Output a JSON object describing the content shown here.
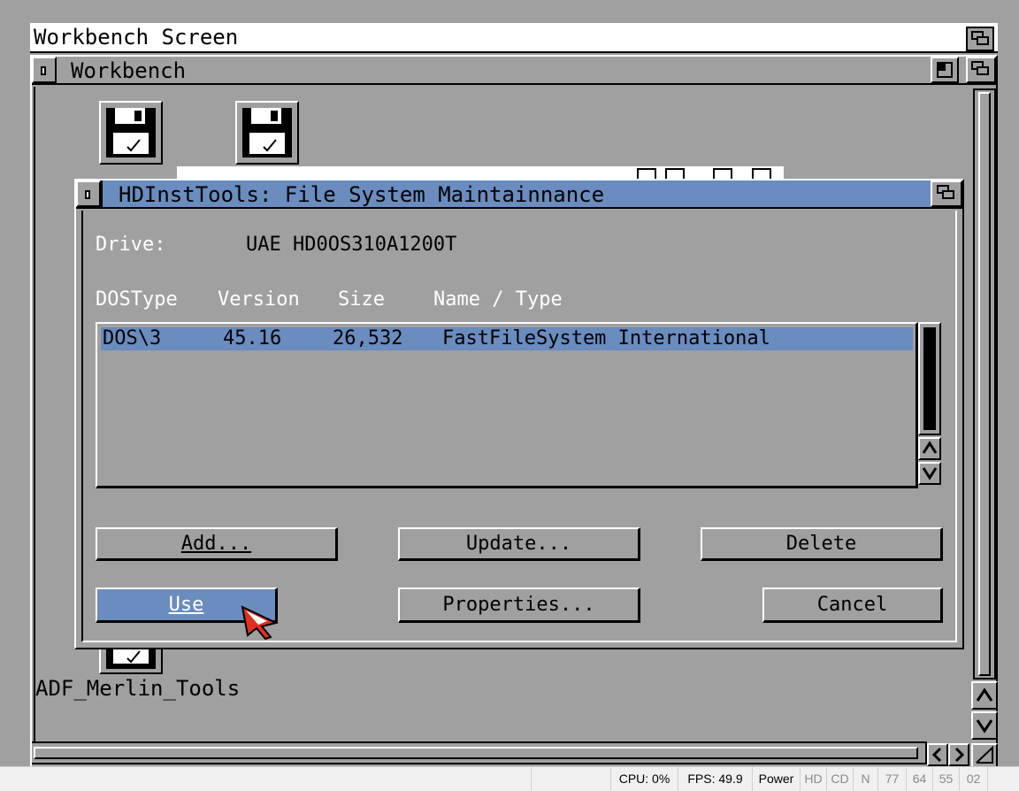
{
  "screen": {
    "title": "Workbench Screen"
  },
  "workbench_window": {
    "title": "Workbench",
    "icons": [
      {
        "label": "ADF_Merlin_Tools"
      }
    ]
  },
  "dialog": {
    "title": "HDInstTools: File System Maintainnance",
    "drive_label": "Drive:",
    "drive_value": "UAE HD0OS310A1200T",
    "columns": [
      "DOSType",
      "Version",
      "Size",
      "Name / Type"
    ],
    "rows": [
      {
        "dostype": "DOS\\3",
        "version": "45.16",
        "size": "26,532",
        "name": "FastFileSystem International",
        "selected": true
      }
    ],
    "buttons": {
      "add": "Add...",
      "update": "Update...",
      "delete": "Delete",
      "use": "Use",
      "properties": "Properties...",
      "cancel": "Cancel"
    }
  },
  "statusbar": {
    "cpu": "CPU: 0%",
    "fps": "FPS: 49.9",
    "power": "Power",
    "hd": "HD",
    "cd": "CD",
    "n": "N",
    "d0": "77",
    "d1": "64",
    "d2": "55",
    "d3": "02"
  },
  "colors": {
    "workbench_gray": "#a0a0a0",
    "title_blue": "#6a8cbe",
    "pointer_red": "#e03020"
  }
}
